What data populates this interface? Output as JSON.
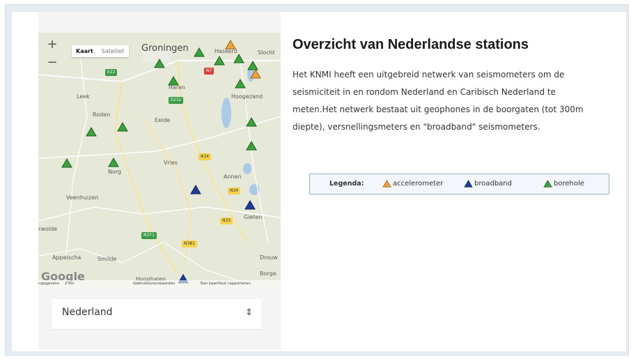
{
  "map": {
    "zoom_in": "+",
    "zoom_out": "−",
    "maptype": {
      "map": "Kaart",
      "satellite": "Satelliet"
    },
    "places": {
      "groningen": "Groningen",
      "haren": "Haren",
      "hoogezand": "Hoogezand",
      "leek": "Leek",
      "roden": "Roden",
      "eelde": "Eelde",
      "vries": "Vries",
      "norg": "Norg",
      "annen": "Annen",
      "veenhuizen": "Veenhuizen",
      "gieten": "Gieten",
      "rwolde": "rwolde",
      "appelscha": "Appelscha",
      "smilde": "Smilde",
      "drouw": "Drouw",
      "borge": "Borge",
      "hoogehaler": "Hooghalen",
      "haskerd": "Haskerd",
      "slocht": "Slocht"
    },
    "roads": {
      "e22": "E22",
      "e232": "E232",
      "n34": "N34",
      "n33": "N33",
      "n371": "N371",
      "n34b": "N34",
      "n381": "N381",
      "n33b": "N33",
      "n7": "N7"
    },
    "footer": {
      "data": "ngegevens",
      "scale": "2 km",
      "terms": "Gebruiksvoorwaarden",
      "report": "Een kaartfout rapporteren"
    },
    "google": "Google"
  },
  "region_select": {
    "value": "Nederland",
    "chevron": "⇕"
  },
  "content": {
    "title": "Overzicht van Nederlandse stations",
    "desc_lines": [
      "Het KNMI heeft een uitgebreid netwerk van seismometers om de",
      "seismiciteit in en rondom Nederland en Caribisch Nederland te",
      "meten.Het netwerk bestaat uit geophones in de boorgaten (tot 300m",
      "diepte), versnellingsmeters en \"broadband\" seismometers."
    ]
  },
  "legend": {
    "label": "Legenda:",
    "accelerometer": "accelerometer",
    "broadband": "broadband",
    "borehole": "borehole"
  },
  "colors": {
    "accelerometer": "#f0a23c",
    "broadband": "#1f3f9a",
    "borehole": "#3aa33c"
  },
  "markers": [
    {
      "type": "borehole"
    },
    {
      "type": "borehole"
    },
    {
      "type": "borehole"
    },
    {
      "type": "borehole"
    },
    {
      "type": "borehole"
    },
    {
      "type": "borehole"
    },
    {
      "type": "borehole"
    },
    {
      "type": "borehole"
    },
    {
      "type": "borehole"
    },
    {
      "type": "borehole"
    },
    {
      "type": "borehole"
    },
    {
      "type": "borehole"
    },
    {
      "type": "borehole"
    },
    {
      "type": "accelerometer"
    },
    {
      "type": "accelerometer"
    },
    {
      "type": "broadband"
    },
    {
      "type": "broadband"
    },
    {
      "type": "broadband"
    }
  ]
}
